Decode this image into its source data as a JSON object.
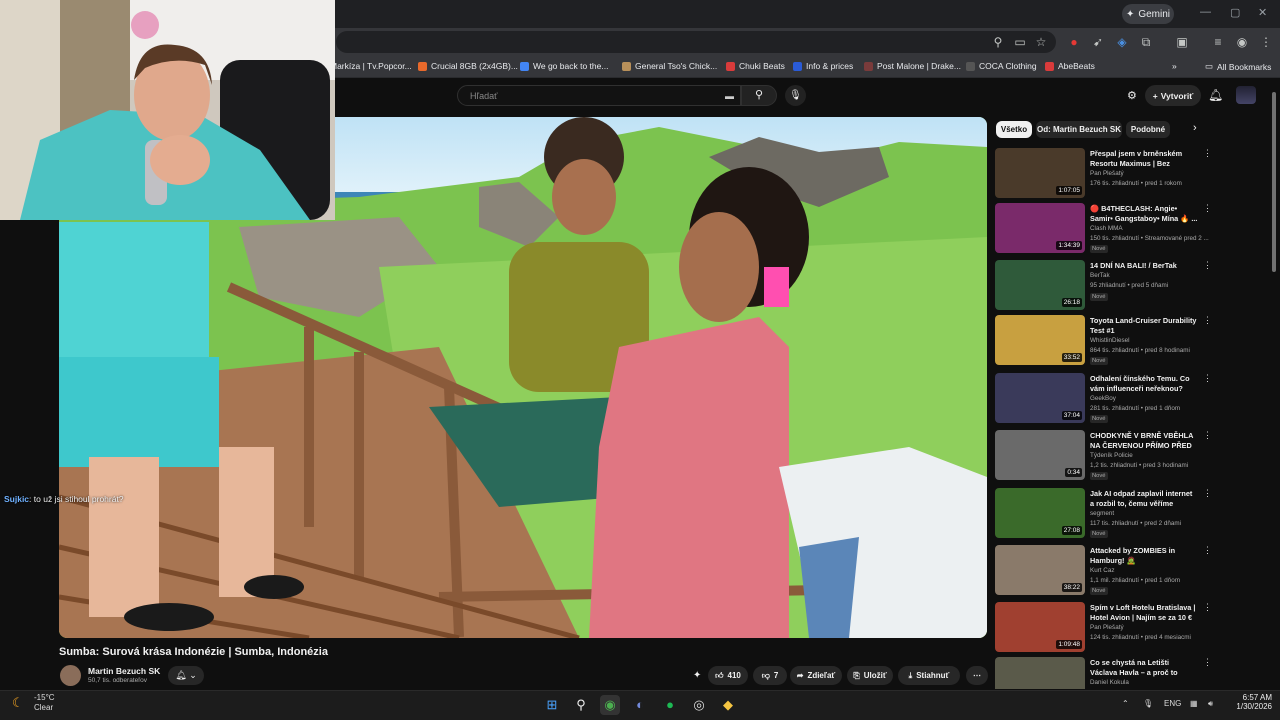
{
  "browser": {
    "gemini_label": "Gemini",
    "bookmarks": [
      {
        "label": "Markíza | Tv.Popcor...",
        "color": "#e05a2b"
      },
      {
        "label": "Crucial 8GB (2x4GB)...",
        "color": "#e8692b"
      },
      {
        "label": "We go back to the...",
        "color": "#4285f4"
      },
      {
        "label": "General Tso's Chick...",
        "color": "#b8905a"
      },
      {
        "label": "Chuki Beats",
        "color": "#d93b3b"
      },
      {
        "label": "Info & prices",
        "color": "#2a5bd7"
      },
      {
        "label": "Post Malone | Drake...",
        "color": "#7a3b3b"
      },
      {
        "label": "COCA Clothing",
        "color": "#222222"
      },
      {
        "label": "AbeBeats",
        "color": "#d93b3b"
      }
    ],
    "all_bookmarks": "All Bookmarks"
  },
  "youtube": {
    "search_placeholder": "Hľadať",
    "create_label": "Vytvoriť",
    "video_title": "Sumba: Surová krása Indonézie | Sumba, Indonézia",
    "channel_name": "Martin Bezuch SK",
    "subscribers": "50,7 tis. odberateľov",
    "likes": "410",
    "dislikes": "7",
    "share": "Zdieľať",
    "save": "Uložiť",
    "download": "Stiahnuť",
    "chips": [
      "Všetko",
      "Od: Martin Bezuch SK",
      "Podobné"
    ],
    "recommendations": [
      {
        "title": "Přespal jsem v brněnském Resortu Maximus | Bez plavek...",
        "channel": "Pan Plešatý",
        "meta": "176 tis. zhliadnutí • pred 1 rokom",
        "duration": "1:07:05",
        "new": "",
        "thumb": "#4a3a2a"
      },
      {
        "title": "🔴 B4THECLASH: Angie• Samir• Gangstaboy• Mína 🔥 ...",
        "channel": "Clash MMA",
        "meta": "150 tis. zhliadnutí • Streamované pred 2 ...",
        "duration": "1:34:39",
        "new": "Nové",
        "thumb": "#7a2a6a"
      },
      {
        "title": "14 DNÍ NA BALI! / BerTak",
        "channel": "BerTak",
        "meta": "95 zhliadnutí • pred 5 dňami",
        "duration": "26:18",
        "new": "Nové",
        "thumb": "#2f5a3a"
      },
      {
        "title": "Toyota Land-Cruiser Durability Test #1",
        "channel": "WhistlinDiesel",
        "meta": "864 tis. zhliadnutí • pred 8 hodinami",
        "duration": "33:52",
        "new": "Nové",
        "thumb": "#c8a040"
      },
      {
        "title": "Odhalení čínského Temu. Co vám influenceři neřeknou?",
        "channel": "GeekBoy",
        "meta": "281 tis. zhliadnutí • pred 1 dňom",
        "duration": "37:04",
        "new": "Nové",
        "thumb": "#3a3a5a"
      },
      {
        "title": "CHODKYNĚ V BRNĚ VBĚHLA NA ČERVENOU PŘÍMO PŘED ...",
        "channel": "Týdeník Policie",
        "meta": "1,2 tis. zhliadnutí • pred 3 hodinami",
        "duration": "0:34",
        "new": "Nové",
        "thumb": "#6a6a6a"
      },
      {
        "title": "Jak AI odpad zaplavil internet a rozbil to, čemu věříme",
        "channel": "segment",
        "meta": "117 tis. zhliadnutí • pred 2 dňami",
        "duration": "27:08",
        "new": "Nové",
        "thumb": "#3a6a2a"
      },
      {
        "title": "Attacked by ZOMBIES in Hamburg! 🧟",
        "channel": "Kurt Caz",
        "meta": "1,1 mil. zhliadnutí • pred 1 dňom",
        "duration": "38:22",
        "new": "Nové",
        "thumb": "#8a7a6a"
      },
      {
        "title": "Spím v Loft Hotelu Bratislava | Hotel Avion | Najím se za 10 € ...",
        "channel": "Pan Plešatý",
        "meta": "124 tis. zhliadnutí • pred 4 mesiacmi",
        "duration": "1:09:48",
        "new": "",
        "thumb": "#a04030"
      },
      {
        "title": "Co se chystá na Letišti Václava Havla – a proč to možná nestačí",
        "channel": "Daniel Kokula",
        "meta": "",
        "duration": "",
        "new": "",
        "thumb": "#5a5a4a"
      }
    ]
  },
  "stream": {
    "chat_user": "Sujkic",
    "chat_text": ": to už jsi stihoul prohrát?"
  },
  "taskbar": {
    "temperature": "-15°C",
    "weather": "Clear",
    "language": "ENG",
    "time": "6:57 AM",
    "date": "1/30/2026"
  }
}
